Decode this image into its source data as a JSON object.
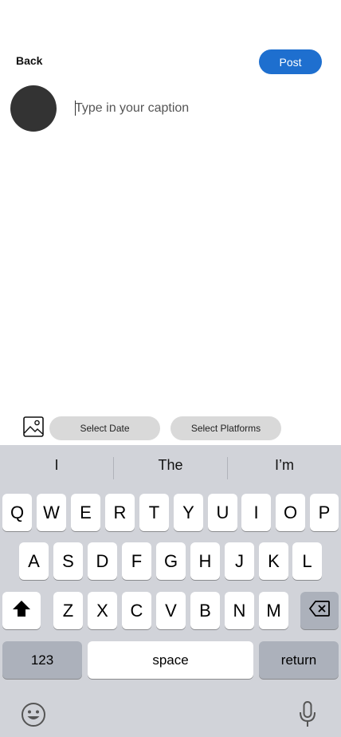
{
  "header": {
    "back_label": "Back",
    "post_label": "Post",
    "accent": "#1e6fcf"
  },
  "composer": {
    "caption_placeholder": "Type in your caption"
  },
  "toolbar": {
    "date_label": "Select Date",
    "platforms_label": "Select Platforms",
    "image_icon": "image-icon"
  },
  "keyboard": {
    "suggestions": [
      "I",
      "The",
      "I’m"
    ],
    "row1": [
      "Q",
      "W",
      "E",
      "R",
      "T",
      "Y",
      "U",
      "I",
      "O",
      "P"
    ],
    "row2": [
      "A",
      "S",
      "D",
      "F",
      "G",
      "H",
      "J",
      "K",
      "L"
    ],
    "row3": [
      "Z",
      "X",
      "C",
      "V",
      "B",
      "N",
      "M"
    ],
    "numbers_label": "123",
    "space_label": "space",
    "return_label": "return",
    "icons": {
      "shift": "shift-icon",
      "backspace": "backspace-icon",
      "emoji": "emoji-icon",
      "mic": "microphone-icon"
    }
  }
}
